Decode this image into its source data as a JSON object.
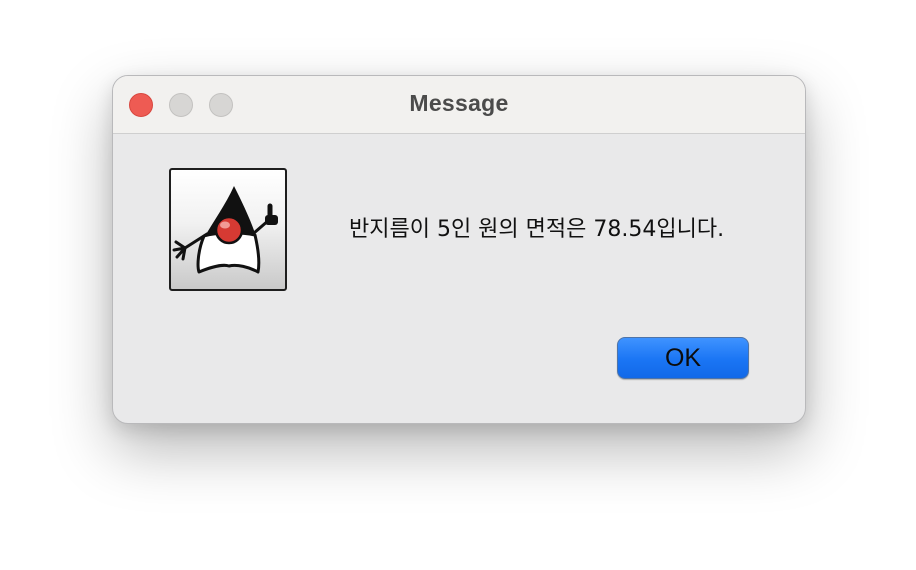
{
  "window": {
    "title": "Message"
  },
  "controls": {
    "close_color": "#ee5b53",
    "inactive_color": "#d7d6d4"
  },
  "dialog": {
    "icon": "java-duke-icon",
    "message": "반지름이 5인 원의 면적은 78.54입니다.",
    "ok_label": "OK",
    "accent_color": "#1a75f4"
  }
}
